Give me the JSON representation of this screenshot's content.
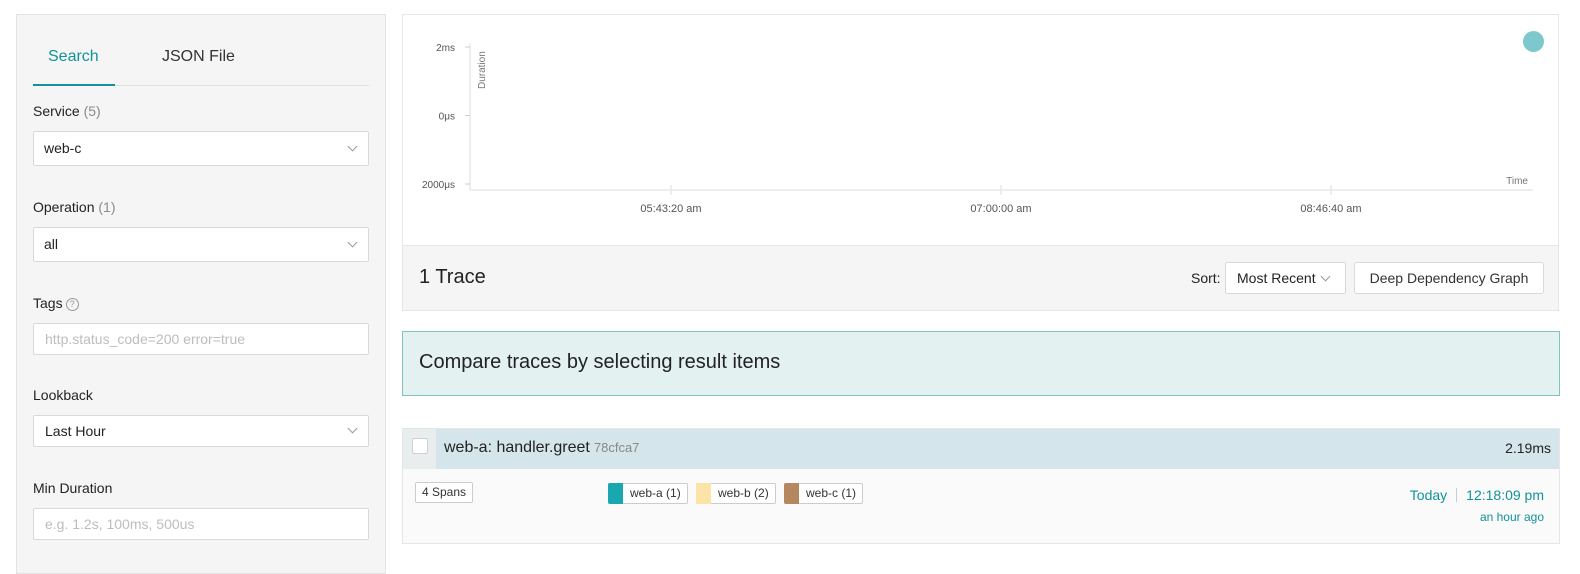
{
  "sidebar": {
    "tabs": [
      {
        "label": "Search",
        "active": true
      },
      {
        "label": "JSON File",
        "active": false
      }
    ],
    "service": {
      "label": "Service",
      "count": "(5)",
      "value": "web-c"
    },
    "operation": {
      "label": "Operation",
      "count": "(1)",
      "value": "all"
    },
    "tags": {
      "label": "Tags",
      "help_icon": "?",
      "placeholder": "http.status_code=200 error=true"
    },
    "lookback": {
      "label": "Lookback",
      "value": "Last Hour"
    },
    "min_duration": {
      "label": "Min Duration",
      "placeholder": "e.g. 1.2s, 100ms, 500us"
    }
  },
  "chart_data": {
    "type": "scatter",
    "title": "",
    "xlabel": "Time",
    "ylabel": "Duration",
    "x_ticks": [
      "05:43:20 am",
      "07:00:00 am",
      "08:46:40 am"
    ],
    "y_ticks": [
      "2ms",
      "0μs",
      "2000μs"
    ],
    "grid": false,
    "legend_placement": "top-right",
    "series": [
      {
        "color": "#7cc8cc",
        "points": []
      }
    ]
  },
  "results": {
    "count_label": "1 Trace",
    "sort_label": "Sort:",
    "sort_value": "Most Recent",
    "ddg_button": "Deep Dependency Graph"
  },
  "compare_banner": "Compare traces by selecting result items",
  "trace": {
    "name": "web-a: handler.greet",
    "id": "78cfca7",
    "duration": "2.19ms",
    "spans": "4 Spans",
    "services": [
      {
        "label": "web-a (1)",
        "color": "#1aa8b0"
      },
      {
        "label": "web-b (2)",
        "color": "#fce3a8"
      },
      {
        "label": "web-c (1)",
        "color": "#b5875e"
      }
    ],
    "day": "Today",
    "time": "12:18:09 pm",
    "ago": "an hour ago"
  }
}
